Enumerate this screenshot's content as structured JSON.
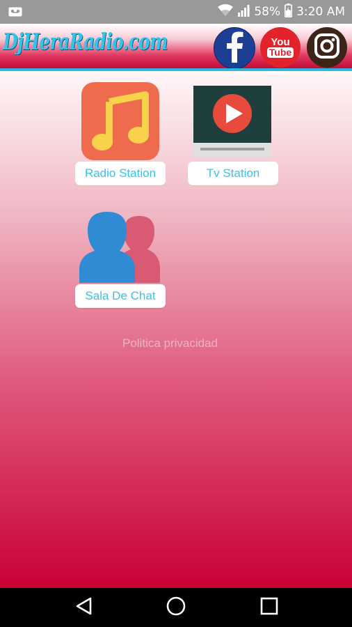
{
  "status_bar": {
    "notification_icon": "voicemail-icon",
    "wifi_icon": "wifi-icon",
    "signal_icon": "cell-signal-icon",
    "battery_percent": "58%",
    "battery_icon": "battery-charging-icon",
    "time": "3:20 AM"
  },
  "header": {
    "logo_text": "DjHeraRadio.com",
    "social": [
      {
        "name": "facebook",
        "icon": "facebook-icon",
        "color": "#1c3f94"
      },
      {
        "name": "youtube",
        "icon": "youtube-icon",
        "text_top": "You",
        "text_bottom": "Tube",
        "color": "#e2232b"
      },
      {
        "name": "instagram",
        "icon": "instagram-icon",
        "color": "#3b2418"
      }
    ]
  },
  "main": {
    "tiles": [
      {
        "label": "Radio Station",
        "icon": "music-note-icon",
        "color": "#ee6b4d"
      },
      {
        "label": "Tv Station",
        "icon": "tv-play-icon",
        "color": "#1f3f3f"
      },
      {
        "label": "Sala De Chat",
        "icon": "users-icon",
        "color": "#2f8bd4"
      }
    ],
    "privacy_link": "Politica privacidad"
  },
  "nav_bar": {
    "back_icon": "back-triangle-icon",
    "home_icon": "home-circle-icon",
    "recents_icon": "recents-square-icon"
  },
  "colors": {
    "accent_cyan": "#33c4ea",
    "brand_red": "#c90035",
    "status_gray": "#999999"
  }
}
